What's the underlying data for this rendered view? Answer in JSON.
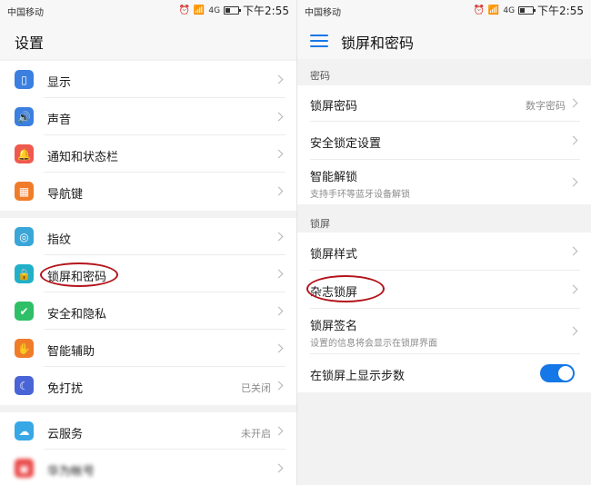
{
  "status_bar": {
    "carrier": "中国移动",
    "network": "4G",
    "time": "下午2:55"
  },
  "settings_screen": {
    "title": "设置",
    "group1": [
      {
        "label": "显示",
        "icon": "display-icon",
        "color": "#3b7fe0"
      },
      {
        "label": "声音",
        "icon": "sound-icon",
        "color": "#3b7fe0"
      },
      {
        "label": "通知和状态栏",
        "icon": "bell-icon",
        "color": "#ef5a4f"
      },
      {
        "label": "导航键",
        "icon": "navigation-key-icon",
        "color": "#f07c2a"
      }
    ],
    "group2": [
      {
        "label": "指纹",
        "icon": "fingerprint-icon",
        "color": "#3aa6d8",
        "value": ""
      },
      {
        "label": "锁屏和密码",
        "icon": "lock-icon",
        "color": "#22b0c8",
        "value": ""
      },
      {
        "label": "安全和隐私",
        "icon": "shield-icon",
        "color": "#2fbf67",
        "value": ""
      },
      {
        "label": "智能辅助",
        "icon": "hand-icon",
        "color": "#f07c2a",
        "value": ""
      },
      {
        "label": "免打扰",
        "icon": "moon-icon",
        "color": "#4964d6",
        "value": "已关闭"
      }
    ],
    "group3": [
      {
        "label": "云服务",
        "icon": "cloud-icon",
        "color": "#37a7e6",
        "value": "未开启"
      },
      {
        "label": "华为帐号",
        "icon": "account-icon",
        "color": "#ea4a4a",
        "value": ""
      }
    ]
  },
  "lock_screen": {
    "title": "锁屏和密码",
    "section_password": "密码",
    "password_rows": [
      {
        "label": "锁屏密码",
        "value": "数字密码",
        "sub": ""
      },
      {
        "label": "安全锁定设置",
        "value": "",
        "sub": ""
      },
      {
        "label": "智能解锁",
        "value": "",
        "sub": "支持手环等蓝牙设备解锁"
      }
    ],
    "section_lockscreen": "锁屏",
    "lock_rows": [
      {
        "label": "锁屏样式",
        "sub": ""
      },
      {
        "label": "杂志锁屏",
        "sub": ""
      },
      {
        "label": "锁屏签名",
        "sub": "设置的信息将会显示在锁屏界面"
      },
      {
        "label": "在锁屏上显示步数",
        "sub": "",
        "toggle_on": true
      }
    ]
  },
  "colors": {
    "accent": "#1677e6",
    "annotation": "#b3141b"
  }
}
